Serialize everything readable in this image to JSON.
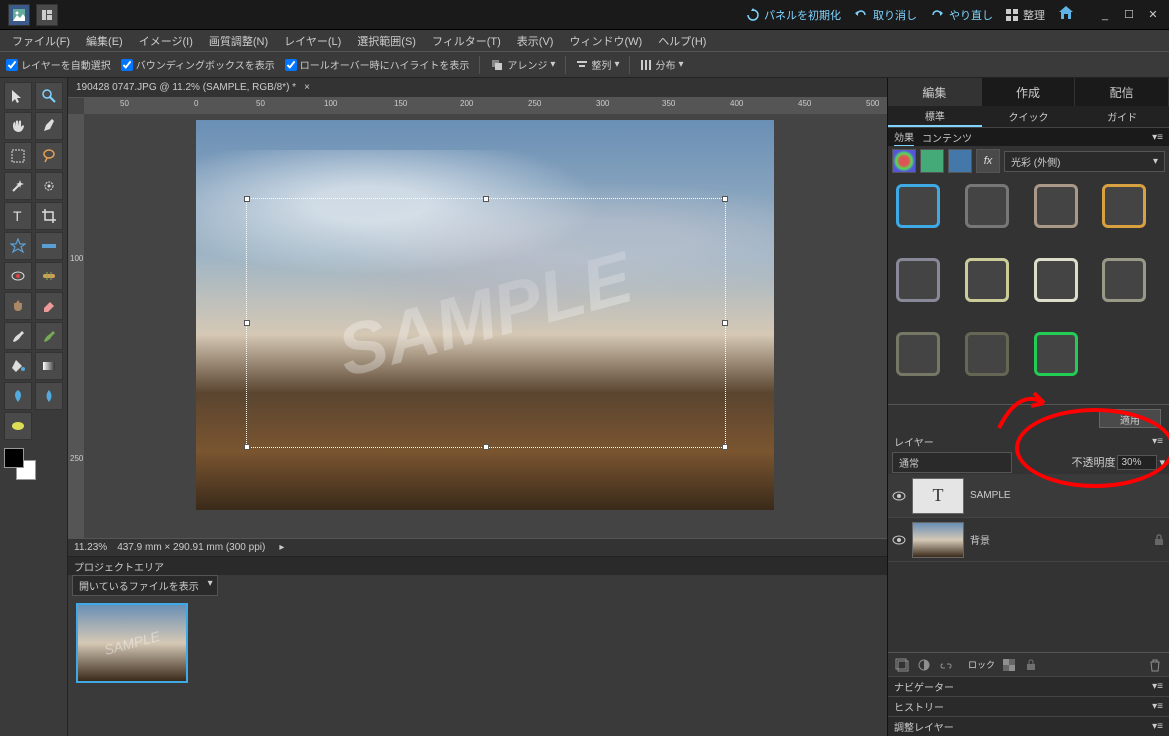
{
  "titlebar": {
    "reset_panels": "パネルを初期化",
    "undo": "取り消し",
    "redo": "やり直し",
    "organize": "整理"
  },
  "menubar": {
    "file": "ファイル(F)",
    "edit": "編集(E)",
    "image": "イメージ(I)",
    "enhance": "画質調整(N)",
    "layer": "レイヤー(L)",
    "select": "選択範囲(S)",
    "filter": "フィルター(T)",
    "view": "表示(V)",
    "window": "ウィンドウ(W)",
    "help": "ヘルプ(H)"
  },
  "options": {
    "auto_select_layer": "レイヤーを自動選択",
    "show_bounding_box": "バウンディングボックスを表示",
    "show_rollover_highlight": "ロールオーバー時にハイライトを表示",
    "arrange": "アレンジ",
    "align": "整列",
    "distribute": "分布"
  },
  "document": {
    "tab_title": "190428 0747.JPG @ 11.2% (SAMPLE, RGB/8*) *",
    "watermark": "SAMPLE"
  },
  "ruler": {
    "r0": "0",
    "r50": "50",
    "r100": "100",
    "r150": "150",
    "r200": "200",
    "r250": "250",
    "r300": "300",
    "r350": "350",
    "r400": "400",
    "r450": "450",
    "r500": "500",
    "v100": "100",
    "v250": "250"
  },
  "status": {
    "zoom": "11.23%",
    "doc_info": "437.9 mm × 290.91 mm (300 ppi)"
  },
  "project_bin": {
    "title": "プロジェクトエリア",
    "dropdown": "開いているファイルを表示"
  },
  "modes": {
    "edit": "編集",
    "create": "作成",
    "share": "配信"
  },
  "submodes": {
    "standard": "標準",
    "quick": "クイック",
    "guided": "ガイド"
  },
  "effects": {
    "tab_effects": "効果",
    "tab_content": "コンテンツ",
    "dropdown": "光彩 (外側)",
    "apply": "適用"
  },
  "layers": {
    "title": "レイヤー",
    "blend_mode": "通常",
    "opacity_label": "不透明度",
    "opacity_value": "30%",
    "layer1_name": "SAMPLE",
    "layer2_name": "背景",
    "lock_label": "ロック"
  },
  "collapsed": {
    "navigator": "ナビゲーター",
    "history": "ヒストリー",
    "adjustment": "調整レイヤー"
  }
}
